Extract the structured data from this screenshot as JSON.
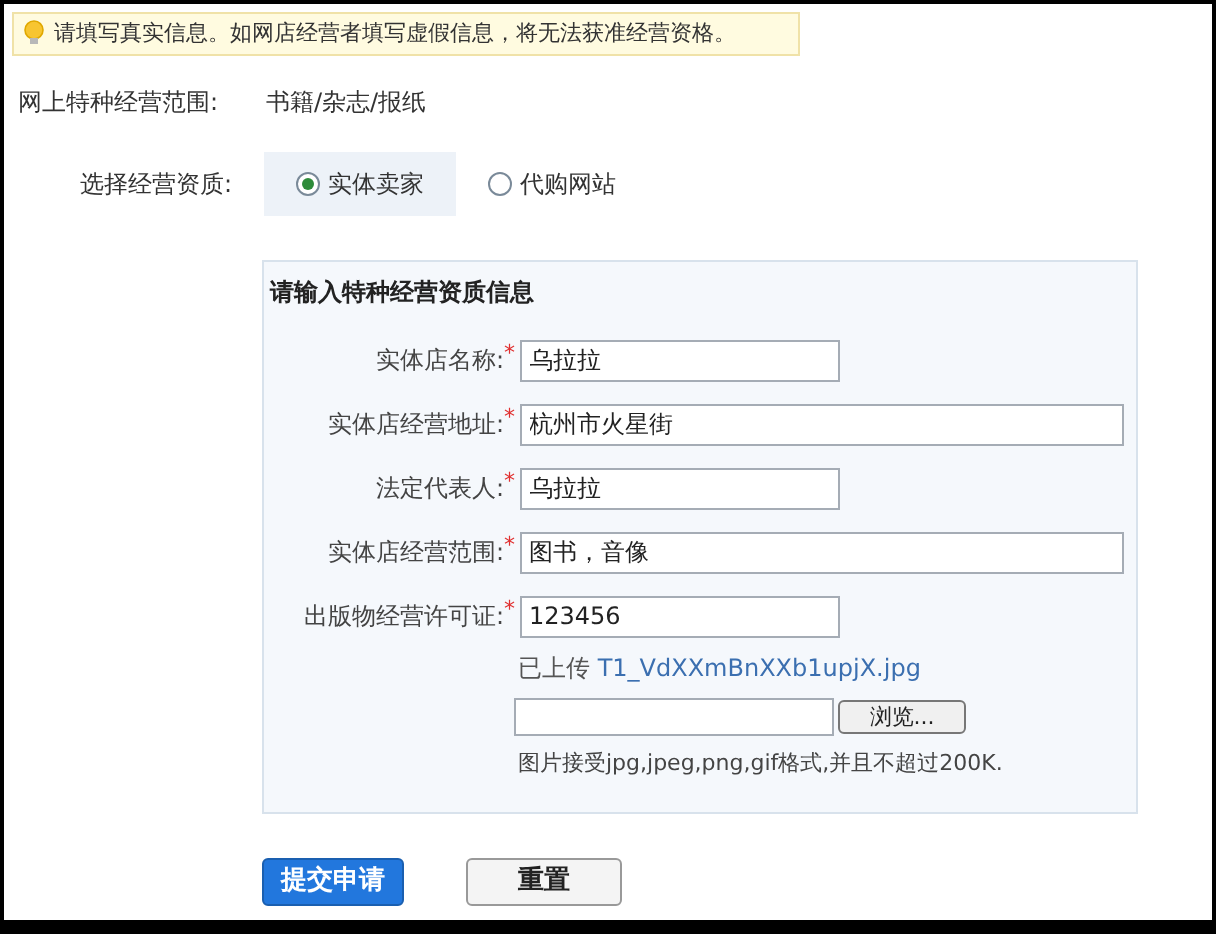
{
  "notice": "请填写真实信息。如网店经营者填写虚假信息，将无法获准经营资格。",
  "scope": {
    "label": "网上特种经营范围:",
    "value": "书籍/杂志/报纸"
  },
  "qualification": {
    "label": "选择经营资质:",
    "options": [
      {
        "label": "实体卖家",
        "selected": true
      },
      {
        "label": "代购网站",
        "selected": false
      }
    ]
  },
  "panel": {
    "title": "请输入特种经营资质信息",
    "fields": [
      {
        "label": "实体店名称:",
        "mark": "*",
        "value": "乌拉拉",
        "kind": "short"
      },
      {
        "label": "实体店经营地址:",
        "mark": "*",
        "value": "杭州市火星街",
        "kind": "long"
      },
      {
        "label": "法定代表人:",
        "mark": "*",
        "value": "乌拉拉",
        "kind": "short"
      },
      {
        "label": "实体店经营范围:",
        "mark": "*",
        "value": "图书，音像",
        "kind": "long"
      },
      {
        "label": "出版物经营许可证:",
        "mark": "*",
        "value": "123456",
        "kind": "short"
      }
    ],
    "uploaded": {
      "prefix": "已上传",
      "file": "T1_VdXXmBnXXb1upjX.jpg"
    },
    "browse_button": "浏览...",
    "hint": "图片接受jpg,jpeg,png,gif格式,并且不超过200K."
  },
  "buttons": [
    {
      "label": "提交申请",
      "kind": "primary"
    },
    {
      "label": "重置",
      "kind": "secondary"
    }
  ]
}
